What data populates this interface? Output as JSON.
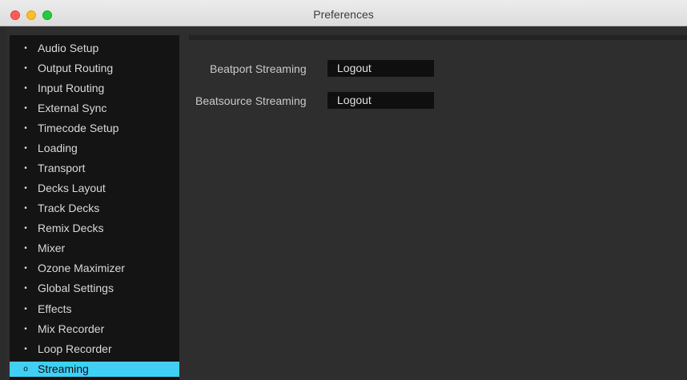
{
  "window": {
    "title": "Preferences"
  },
  "sidebar": {
    "items": [
      {
        "label": "Audio Setup",
        "selected": false
      },
      {
        "label": "Output Routing",
        "selected": false
      },
      {
        "label": "Input Routing",
        "selected": false
      },
      {
        "label": "External Sync",
        "selected": false
      },
      {
        "label": "Timecode Setup",
        "selected": false
      },
      {
        "label": "Loading",
        "selected": false
      },
      {
        "label": "Transport",
        "selected": false
      },
      {
        "label": "Decks Layout",
        "selected": false
      },
      {
        "label": "Track Decks",
        "selected": false
      },
      {
        "label": "Remix Decks",
        "selected": false
      },
      {
        "label": "Mixer",
        "selected": false
      },
      {
        "label": "Ozone Maximizer",
        "selected": false
      },
      {
        "label": "Global Settings",
        "selected": false
      },
      {
        "label": "Effects",
        "selected": false
      },
      {
        "label": "Mix Recorder",
        "selected": false
      },
      {
        "label": "Loop Recorder",
        "selected": false
      },
      {
        "label": "Streaming",
        "selected": true
      }
    ],
    "bullet": "•",
    "selected_bullet": "o"
  },
  "streaming": {
    "rows": [
      {
        "label": "Beatport Streaming",
        "button": "Logout"
      },
      {
        "label": "Beatsource Streaming",
        "button": "Logout"
      }
    ]
  },
  "colors": {
    "accent": "#3fd1f5",
    "sidebar_bg": "#141414",
    "panel_bg": "#2e2e2e"
  }
}
